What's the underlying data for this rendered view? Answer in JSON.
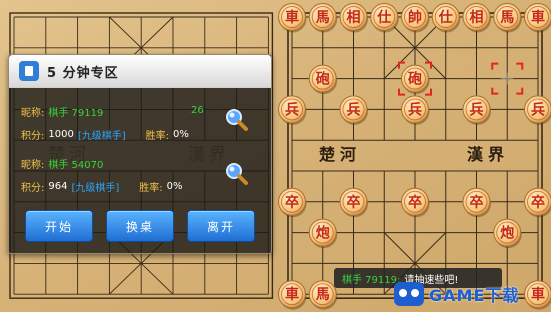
{
  "board": {
    "river_left": "楚河",
    "river_right": "漢界",
    "faded_left": "楚河",
    "faded_right": "漢界",
    "pieces": [
      {
        "col": 0,
        "row": 0,
        "ch": "車"
      },
      {
        "col": 1,
        "row": 0,
        "ch": "馬"
      },
      {
        "col": 2,
        "row": 0,
        "ch": "相"
      },
      {
        "col": 3,
        "row": 0,
        "ch": "仕"
      },
      {
        "col": 4,
        "row": 0,
        "ch": "帥"
      },
      {
        "col": 5,
        "row": 0,
        "ch": "仕"
      },
      {
        "col": 6,
        "row": 0,
        "ch": "相"
      },
      {
        "col": 7,
        "row": 0,
        "ch": "馬"
      },
      {
        "col": 8,
        "row": 0,
        "ch": "車"
      },
      {
        "col": 1,
        "row": 2,
        "ch": "砲"
      },
      {
        "col": 4,
        "row": 2,
        "ch": "砲",
        "selected": true
      },
      {
        "col": 0,
        "row": 3,
        "ch": "兵"
      },
      {
        "col": 2,
        "row": 3,
        "ch": "兵"
      },
      {
        "col": 4,
        "row": 3,
        "ch": "兵"
      },
      {
        "col": 6,
        "row": 3,
        "ch": "兵"
      },
      {
        "col": 8,
        "row": 3,
        "ch": "兵"
      },
      {
        "col": 0,
        "row": 6,
        "ch": "卒"
      },
      {
        "col": 2,
        "row": 6,
        "ch": "卒"
      },
      {
        "col": 4,
        "row": 6,
        "ch": "卒"
      },
      {
        "col": 6,
        "row": 6,
        "ch": "卒"
      },
      {
        "col": 8,
        "row": 6,
        "ch": "卒"
      },
      {
        "col": 1,
        "row": 7,
        "ch": "炮"
      },
      {
        "col": 7,
        "row": 7,
        "ch": "炮"
      },
      {
        "col": 0,
        "row": 9,
        "ch": "車"
      },
      {
        "col": 1,
        "row": 9,
        "ch": "馬"
      },
      {
        "col": 8,
        "row": 9,
        "ch": "車"
      }
    ],
    "move_target": {
      "col": 7,
      "row": 2
    }
  },
  "dialog": {
    "title": "5 分钟专区",
    "players": [
      {
        "nick_label": "昵称:",
        "nick": "棋手 79119",
        "score": "26",
        "points_label": "积分:",
        "points": "1000",
        "level": "[九级棋手]",
        "winrate_label": "胜率:",
        "winrate": "0%"
      },
      {
        "nick_label": "昵称:",
        "nick": "棋手 54070",
        "points_label": "积分:",
        "points": "964",
        "level": "[九级棋手]",
        "winrate_label": "胜率:",
        "winrate": "0%"
      }
    ],
    "buttons": {
      "start": "开始",
      "change": "换桌",
      "leave": "离开"
    }
  },
  "toast": {
    "name": "棋手 79119:",
    "message": "请抽速些吧!"
  },
  "watermark": {
    "text": "GAME下载",
    "icon": "gamepad-logo-icon"
  },
  "colors": {
    "board": "#d8b77e",
    "piece_red": "#c8261a",
    "piece_face": "#f5d28a",
    "dialog_bg": "#181816",
    "nick_green": "#39d23c",
    "level_blue": "#2aa6ff",
    "label_gold": "#f1c24b",
    "button_blue": "#2a86e6"
  }
}
